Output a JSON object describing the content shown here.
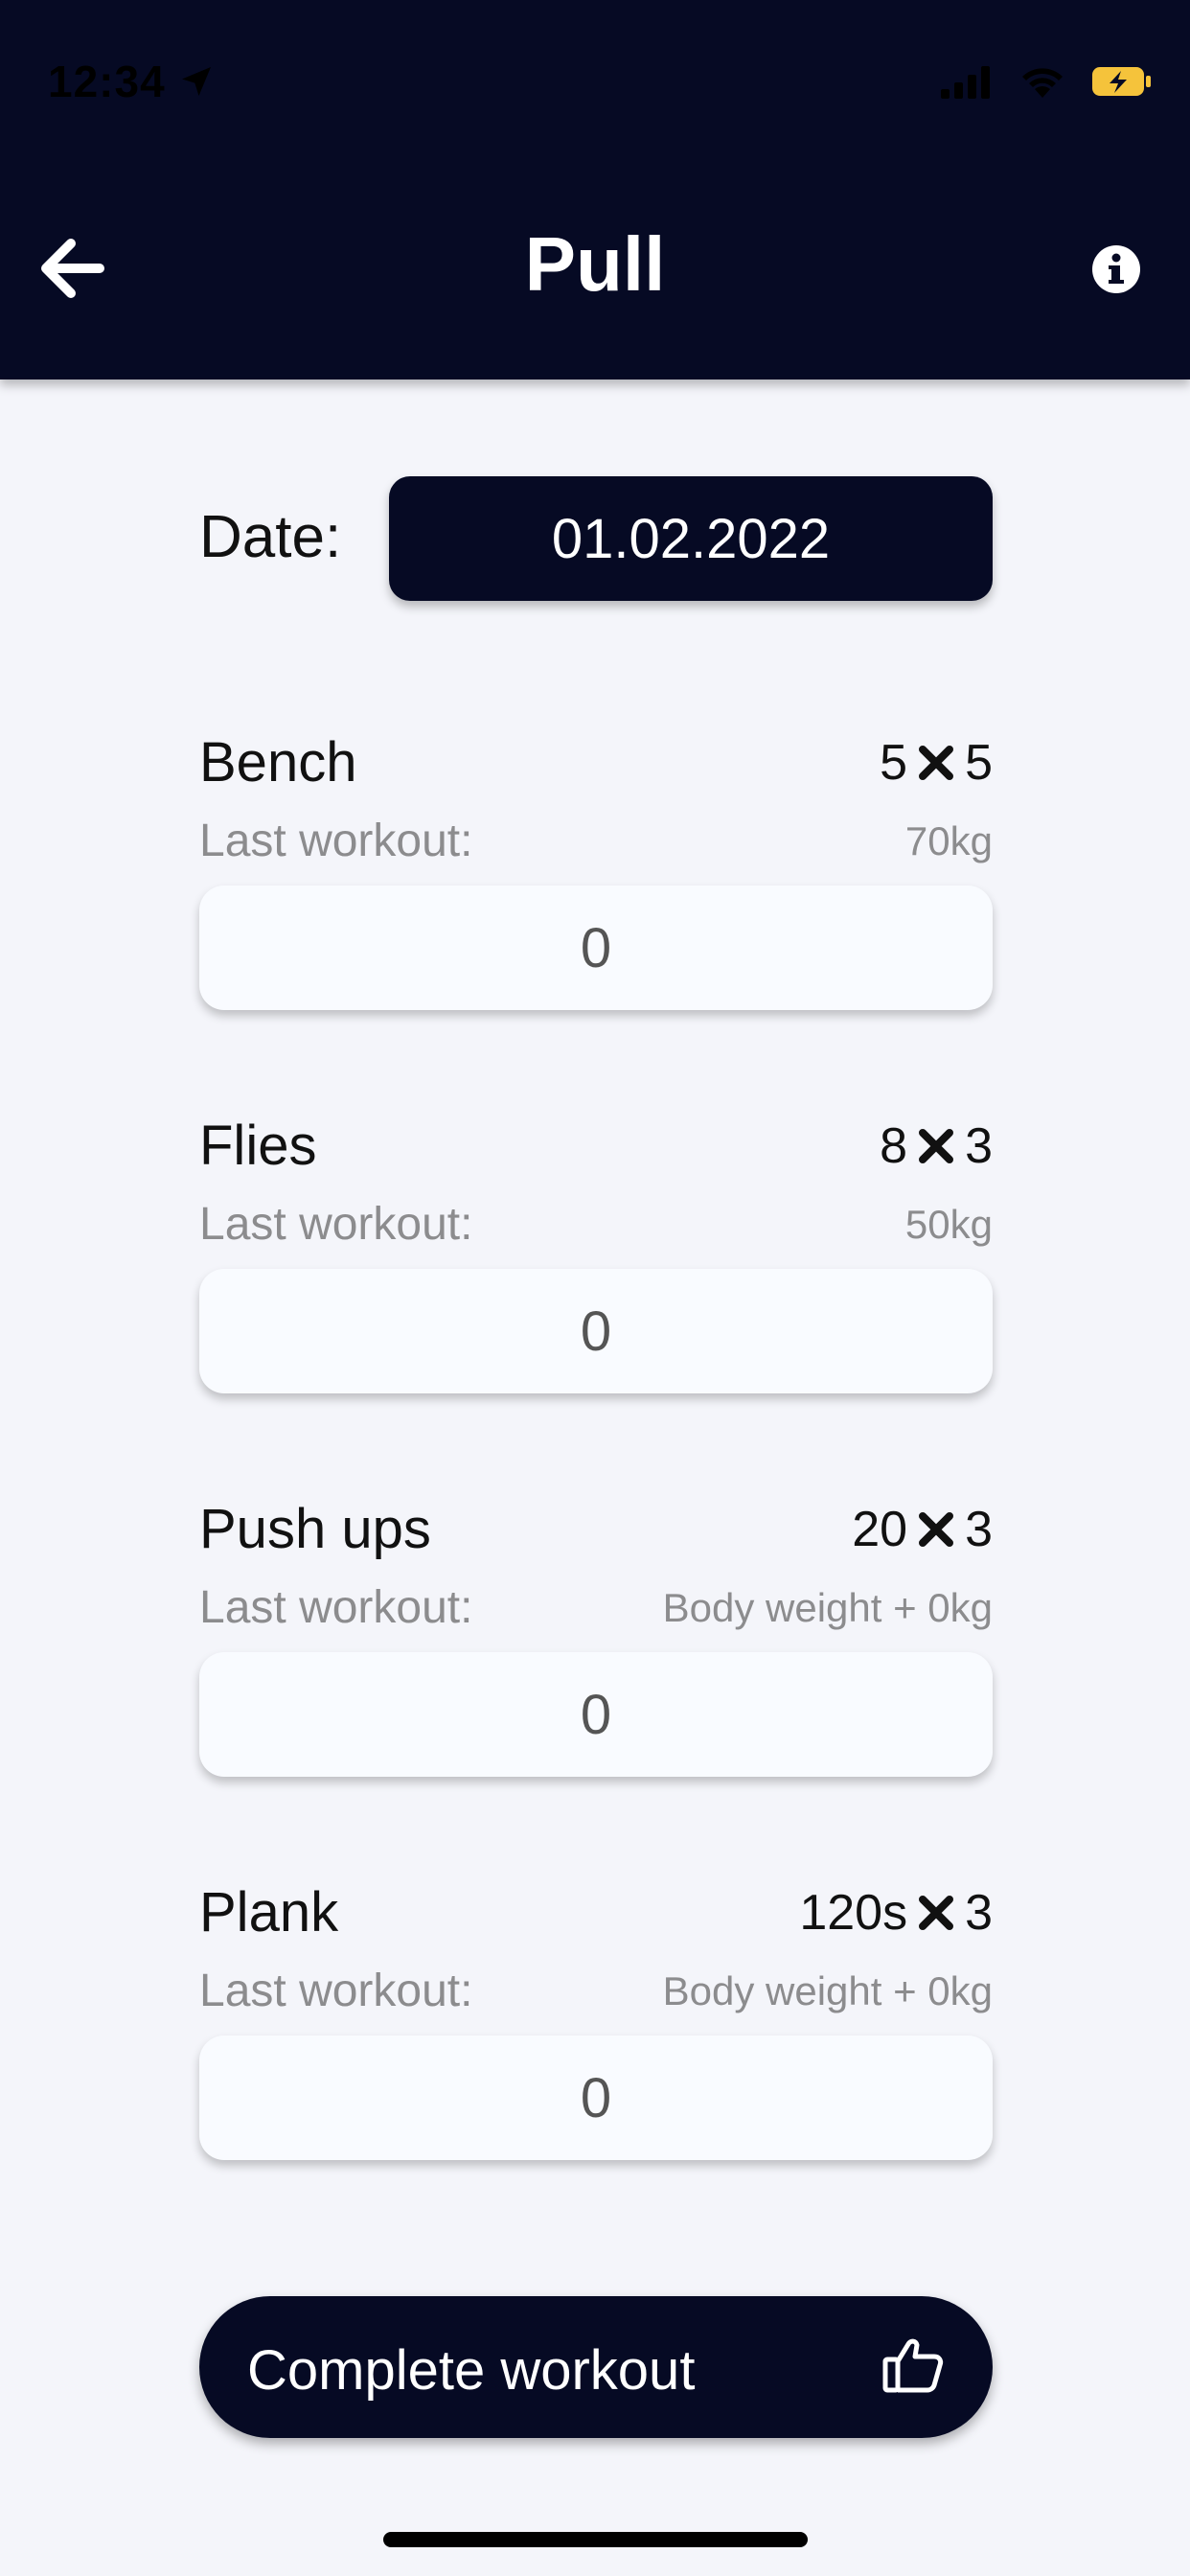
{
  "status_bar": {
    "time": "12:34"
  },
  "header": {
    "title": "Pull"
  },
  "date": {
    "label": "Date:",
    "value": "01.02.2022"
  },
  "exercises": [
    {
      "name": "Bench",
      "reps": "5",
      "sets": "5",
      "last_label": "Last workout:",
      "last_value": "70kg",
      "input_value": "0"
    },
    {
      "name": "Flies",
      "reps": "8",
      "sets": "3",
      "last_label": "Last workout:",
      "last_value": "50kg",
      "input_value": "0"
    },
    {
      "name": "Push ups",
      "reps": "20",
      "sets": "3",
      "last_label": "Last workout:",
      "last_value": "Body weight + 0kg",
      "input_value": "0"
    },
    {
      "name": "Plank",
      "reps": "120s",
      "sets": "3",
      "last_label": "Last workout:",
      "last_value": "Body weight + 0kg",
      "input_value": "0"
    }
  ],
  "complete_button": {
    "label": "Complete workout"
  },
  "icons": {
    "back": "arrow-left-icon",
    "info": "info-icon",
    "thumb": "thumbs-up-icon",
    "multiply": "x-icon",
    "location": "location-arrow-icon",
    "signal": "cellular-signal-icon",
    "wifi": "wifi-icon",
    "battery": "battery-charging-icon"
  },
  "colors": {
    "header_bg": "#060a24",
    "page_bg": "#f4f5fa",
    "battery": "#f5c33b"
  }
}
